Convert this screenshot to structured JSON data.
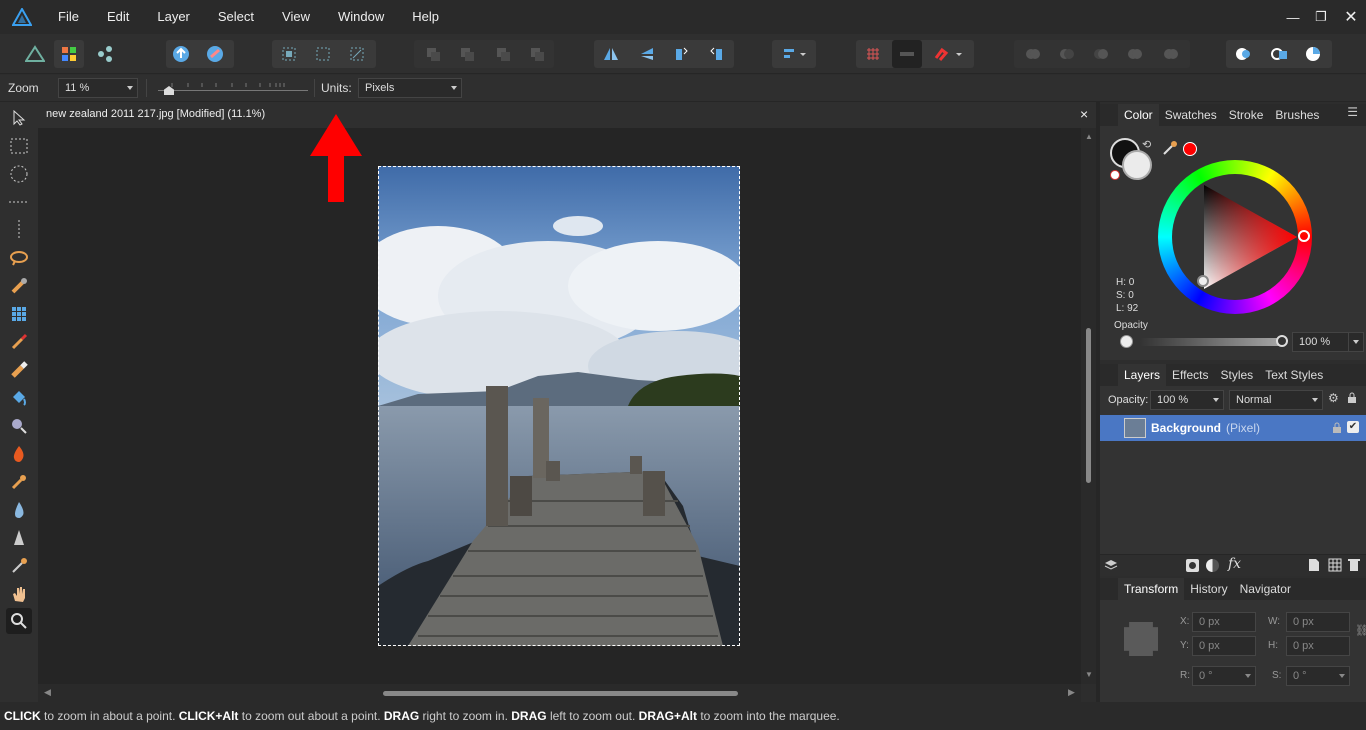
{
  "menu": [
    "File",
    "Edit",
    "Layer",
    "Select",
    "View",
    "Window",
    "Help"
  ],
  "context": {
    "zoom_label": "Zoom",
    "zoom_value": "11 %",
    "units_label": "Units:",
    "units_value": "Pixels"
  },
  "document": {
    "title": "new zealand 2011 217.jpg [Modified] (11.1%)",
    "close": "×"
  },
  "color_panel": {
    "tabs": [
      "Color",
      "Swatches",
      "Stroke",
      "Brushes"
    ],
    "h": "H: 0",
    "s": "S: 0",
    "l": "L: 92",
    "opacity_label": "Opacity",
    "opacity_value": "100 %",
    "primary_color": "#111111",
    "secondary_color": "#ebebeb",
    "picked_color": "#ff0000"
  },
  "layers_panel": {
    "tabs": [
      "Layers",
      "Effects",
      "Styles",
      "Text Styles"
    ],
    "opacity_label": "Opacity:",
    "opacity_value": "100 %",
    "blend_mode": "Normal",
    "layer_name": "Background",
    "layer_type": "(Pixel)"
  },
  "transform_panel": {
    "tabs": [
      "Transform",
      "History",
      "Navigator"
    ],
    "x_label": "X:",
    "x_value": "0 px",
    "y_label": "Y:",
    "y_value": "0 px",
    "w_label": "W:",
    "w_value": "0 px",
    "h_label": "H:",
    "h_value": "0 px",
    "r_label": "R:",
    "r_value": "0 °",
    "s_label": "S:",
    "s_value": "0 °"
  },
  "status": {
    "k1": "CLICK",
    "t1": " to zoom in about a point. ",
    "k2": "CLICK+Alt",
    "t2": " to zoom out about a point. ",
    "k3": "DRAG",
    "t3": " right to zoom in. ",
    "k4": "DRAG",
    "t4": " left to zoom out. ",
    "k5": "DRAG+Alt",
    "t5": " to zoom into the marquee."
  },
  "colors": {
    "accent_red": "#ff0000",
    "selection_blue": "#4a77c4",
    "app_blue": "#3aa0f0"
  }
}
